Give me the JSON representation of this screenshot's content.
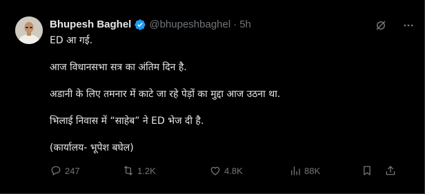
{
  "author": {
    "name": "Bhupesh Baghel",
    "handle": "@bhupeshbaghel",
    "separator": "·",
    "time": "5h"
  },
  "body": {
    "lines": [
      "ED आ गई.",
      "आज विधानसभा सत्र का अंतिम दिन है.",
      "अडानी के लिए तमनार में काटे जा रहे पेड़ों का मुद्दा आज उठना था.",
      "भिलाई निवास में “साहेब” ने ED भेज दी है.",
      "(कार्यालय- भूपेश बघेल)"
    ]
  },
  "actions": {
    "replies": "247",
    "reposts": "1.2K",
    "likes": "4.8K",
    "views": "88K"
  },
  "colors": {
    "background": "#000000",
    "text": "#e7e9ea",
    "muted": "#71767b",
    "verified": "#1d9bf0"
  },
  "icons": [
    "verified-badge-icon",
    "grok-icon",
    "more-icon",
    "reply-icon",
    "repost-icon",
    "like-icon",
    "views-icon",
    "bookmark-icon",
    "share-icon"
  ]
}
